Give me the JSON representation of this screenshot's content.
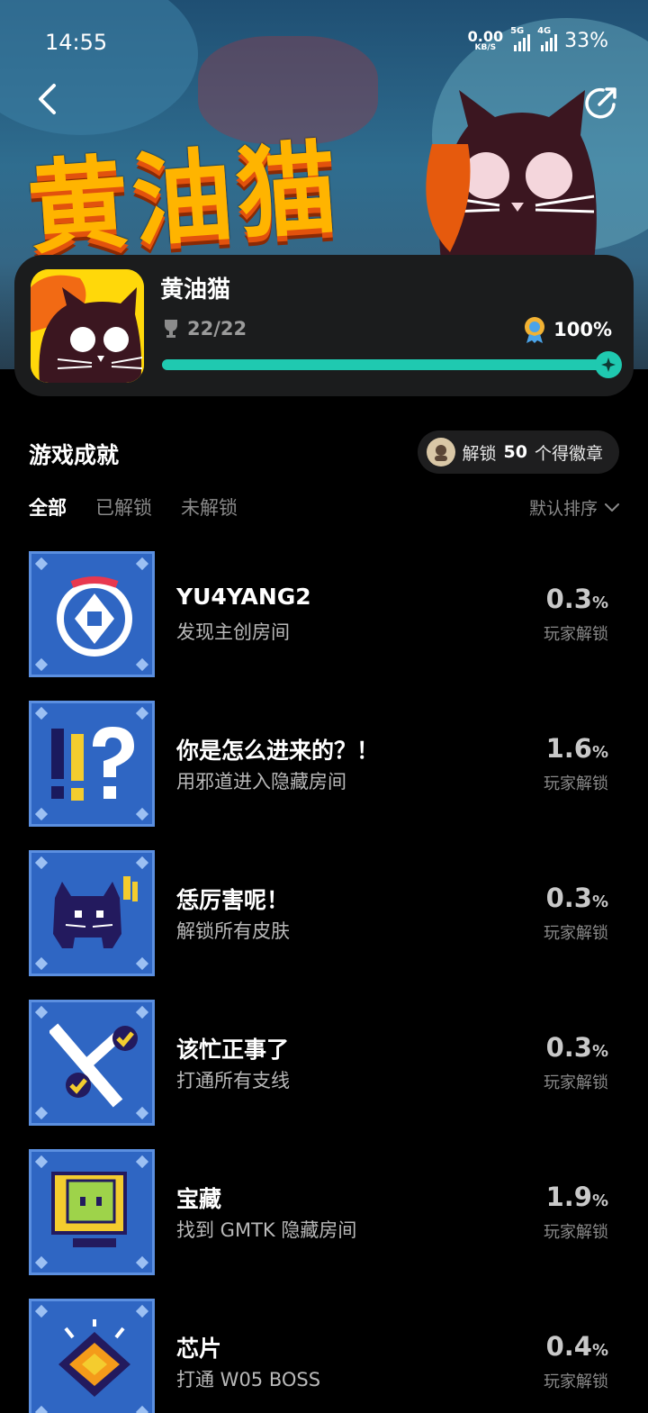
{
  "status_bar": {
    "time": "14:55",
    "net_speed": "0.00",
    "net_unit": "KB/S",
    "signal1_tag": "5G",
    "signal2_tag": "4G",
    "battery": "33%"
  },
  "hero": {
    "art_title": "黄油猫"
  },
  "game": {
    "name": "黄油猫",
    "trophies": "22/22",
    "completion": "100%",
    "completion_fraction": 1.0
  },
  "section": {
    "title": "游戏成就",
    "badge_prefix": "解锁",
    "badge_count": "50",
    "badge_suffix": "个得徽章"
  },
  "tabs": [
    {
      "label": "全部",
      "active": true
    },
    {
      "label": "已解锁",
      "active": false
    },
    {
      "label": "未解锁",
      "active": false
    }
  ],
  "sort_label": "默认排序",
  "achievements": [
    {
      "title": "YU4YANG2",
      "desc": "发现主创房间",
      "rate": "0.3",
      "unit": "%",
      "rate_label": "玩家解锁",
      "icon": "dpad-icon"
    },
    {
      "title": "你是怎么进来的？！",
      "desc": "用邪道进入隐藏房间",
      "rate": "1.6",
      "unit": "%",
      "rate_label": "玩家解锁",
      "icon": "exclaim-question-icon"
    },
    {
      "title": "恁厉害呢！",
      "desc": "解锁所有皮肤",
      "rate": "0.3",
      "unit": "%",
      "rate_label": "玩家解锁",
      "icon": "cat-icon"
    },
    {
      "title": "该忙正事了",
      "desc": "打通所有支线",
      "rate": "0.3",
      "unit": "%",
      "rate_label": "玩家解锁",
      "icon": "checklist-icon"
    },
    {
      "title": "宝藏",
      "desc": "找到 GMTK 隐藏房间",
      "rate": "1.9",
      "unit": "%",
      "rate_label": "玩家解锁",
      "icon": "monitor-icon"
    },
    {
      "title": "芯片",
      "desc": "打通 W05 BOSS",
      "rate": "0.4",
      "unit": "%",
      "rate_label": "玩家解锁",
      "icon": "chip-icon"
    }
  ],
  "colors": {
    "accent": "#1fc9b0",
    "card_bg": "#1b1c1d",
    "icon_bg": "#2f66c3"
  }
}
